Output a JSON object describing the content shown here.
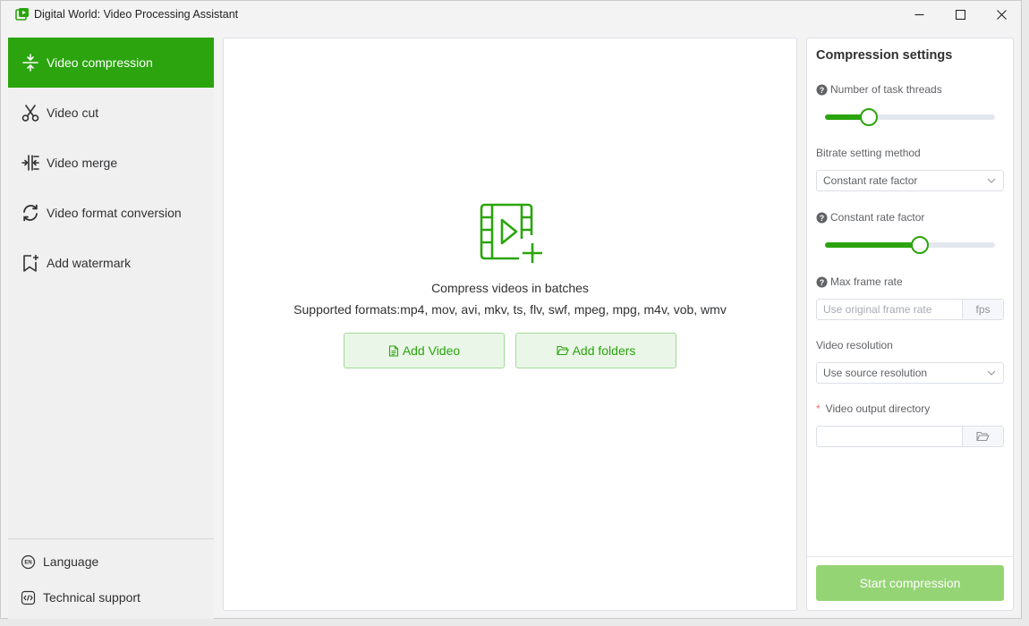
{
  "window": {
    "title": "Digital World: Video Processing Assistant"
  },
  "sidebar": {
    "items": [
      {
        "label": "Video compression",
        "icon": "compress-icon",
        "active": true
      },
      {
        "label": "Video cut",
        "icon": "scissors-icon"
      },
      {
        "label": "Video merge",
        "icon": "merge-icon"
      },
      {
        "label": "Video format conversion",
        "icon": "convert-icon"
      },
      {
        "label": "Add watermark",
        "icon": "bookmark-plus-icon"
      }
    ],
    "language_label": "Language",
    "support_label": "Technical support"
  },
  "main": {
    "title": "Compress videos in batches",
    "formats": "Supported formats:mp4, mov, avi, mkv, ts, flv, swf, mpeg, mpg, m4v, vob, wmv",
    "add_video_label": "Add Video",
    "add_folders_label": "Add folders"
  },
  "settings": {
    "title": "Compression settings",
    "threads_label": "Number of task threads",
    "threads_level": 0.25,
    "bitrate_method_label": "Bitrate setting method",
    "bitrate_method_value": "Constant rate factor",
    "crf_label": "Constant rate factor",
    "crf_level": 0.55,
    "max_fps_label": "Max frame rate",
    "max_fps_placeholder": "Use original frame rate",
    "fps_unit": "fps",
    "resolution_label": "Video resolution",
    "resolution_value": "Use source resolution",
    "required_mark": "*",
    "output_dir_label": "Video output directory",
    "start_label": "Start compression"
  },
  "colors": {
    "accent": "#2ba40e",
    "accent_light": "#eaf6e7",
    "button_disabled": "#95d475"
  }
}
